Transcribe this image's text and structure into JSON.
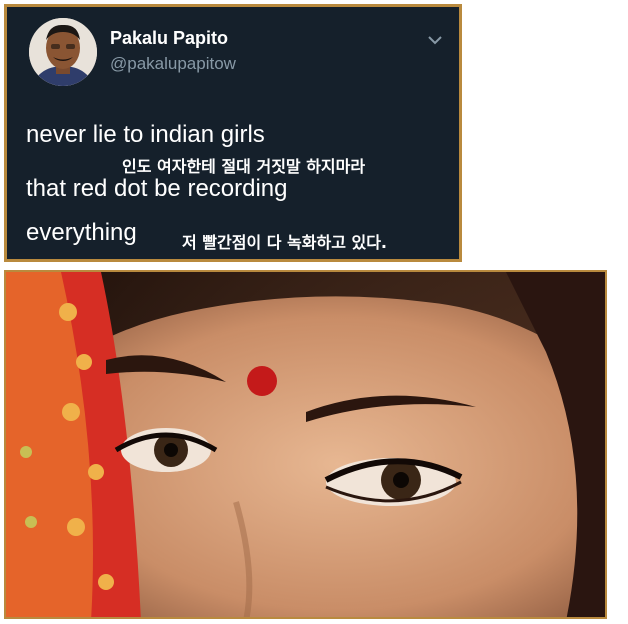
{
  "tweet": {
    "display_name": "Pakalu Papito",
    "handle": "@pakalupapitow",
    "text_line1": "never lie to indian girls",
    "text_line2": "that red dot be recording",
    "text_line3": "everything",
    "caption_ko_1": "인도 여자한테 절대 거짓말 하지마라",
    "caption_ko_2": "저 빨간점이 다 녹화하고 있다."
  },
  "icons": {
    "menu": "chevron-down-icon"
  },
  "colors": {
    "card_bg": "#15202b",
    "border": "#b98a3e",
    "handle": "#8899a6",
    "bindi": "#c41a1a"
  }
}
